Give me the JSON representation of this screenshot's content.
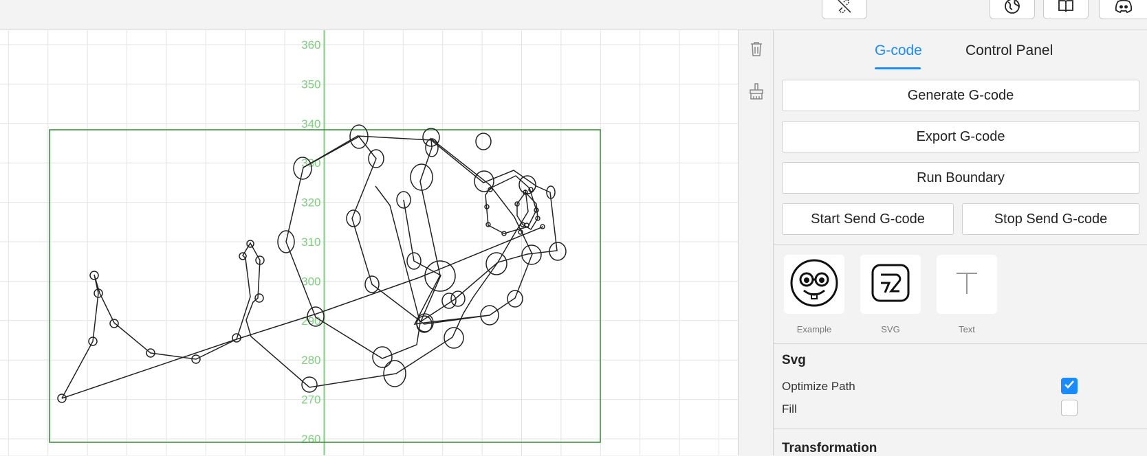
{
  "topbar": {
    "buttons": [
      {
        "name": "disconnect-button",
        "icon": "link-off-icon"
      },
      {
        "name": "language-button",
        "icon": "globe-icon"
      },
      {
        "name": "docs-button",
        "icon": "book-icon"
      },
      {
        "name": "discord-button",
        "icon": "discord-icon"
      }
    ]
  },
  "canvas": {
    "axis_color": "#7fcf7f",
    "bound_color": "#2e8b2e",
    "y_ticks": [
      "360",
      "350",
      "340",
      "330",
      "320",
      "310",
      "300",
      "290",
      "280",
      "270",
      "260"
    ]
  },
  "tools": {
    "icons": [
      "trash-icon",
      "brush-icon"
    ]
  },
  "panel": {
    "tabs": [
      {
        "label": "G-code",
        "active": true
      },
      {
        "label": "Control Panel",
        "active": false
      }
    ],
    "buttons": {
      "generate": "Generate G-code",
      "export": "Export G-code",
      "boundary": "Run Boundary",
      "start": "Start Send G-code",
      "stop": "Stop Send G-code"
    },
    "cards": [
      {
        "label": "Example",
        "icon": "smiley-glasses-icon"
      },
      {
        "label": "SVG",
        "icon": "svg-logo-icon"
      },
      {
        "label": "Text",
        "icon": "text-icon"
      }
    ],
    "svg_section": {
      "title": "Svg",
      "options": [
        {
          "label": "Optimize Path",
          "checked": true
        },
        {
          "label": "Fill",
          "checked": false
        }
      ]
    },
    "transformation_title": "Transformation",
    "accent_color": "#1a8cff"
  }
}
